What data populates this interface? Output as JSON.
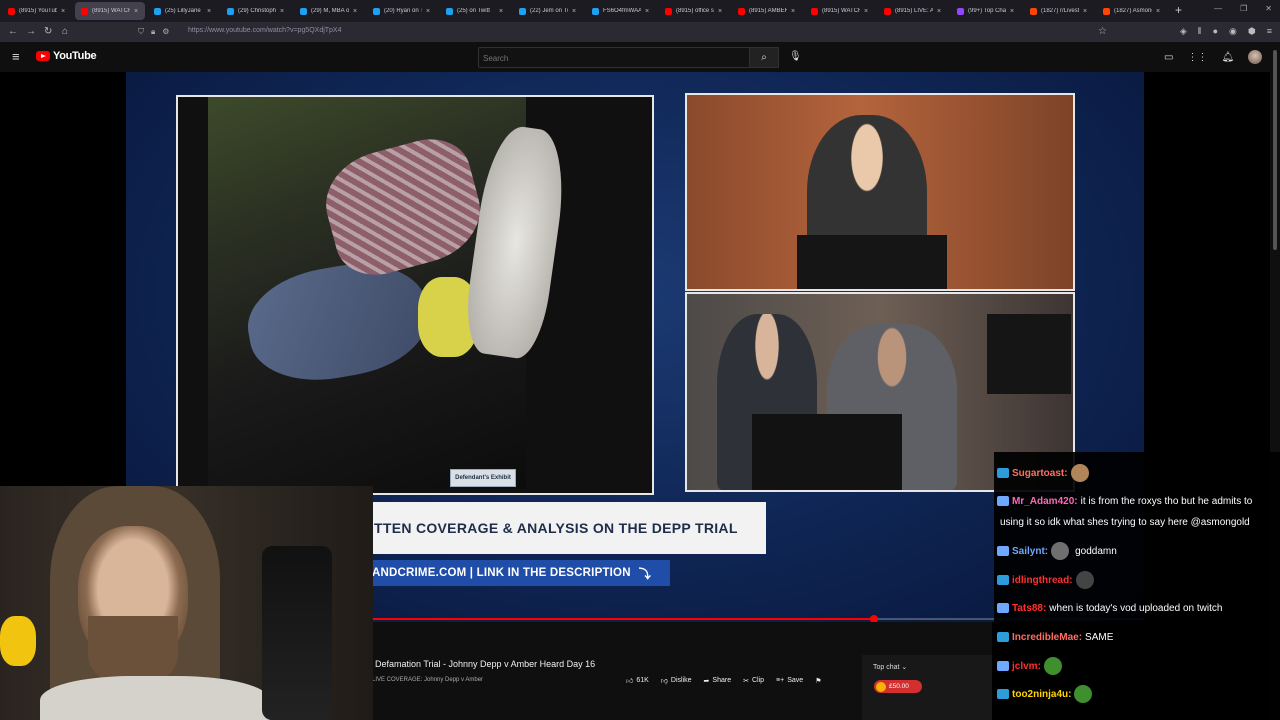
{
  "browser": {
    "tabs": [
      {
        "label": "(8915) YouTube",
        "color": "#ff0000",
        "active": false
      },
      {
        "label": "(8915) WATCH L",
        "color": "#ff0000",
        "active": true
      },
      {
        "label": "(25) LillyJane",
        "color": "#1da1f2",
        "active": false
      },
      {
        "label": "(29) Christophe",
        "color": "#1da1f2",
        "active": false
      },
      {
        "label": "(29) M, MBA on",
        "color": "#1da1f2",
        "active": false
      },
      {
        "label": "(20) Ryan on Twi",
        "color": "#1da1f2",
        "active": false
      },
      {
        "label": "(25) on Twitt",
        "color": "#1da1f2",
        "active": false
      },
      {
        "label": "(22) Jem on Twit",
        "color": "#1da1f2",
        "active": false
      },
      {
        "label": "FS6O4fmWAAU",
        "color": "#1da1f2",
        "active": false
      },
      {
        "label": "(8915) office sp",
        "color": "#ff0000",
        "active": false
      },
      {
        "label": "(8915) AMBER H",
        "color": "#ff0000",
        "active": false
      },
      {
        "label": "(8915) WATCH L",
        "color": "#ff0000",
        "active": false
      },
      {
        "label": "(8915) LIVE: Am",
        "color": "#ff0000",
        "active": false
      },
      {
        "label": "(99+) Top Chan",
        "color": "#9146ff",
        "active": false
      },
      {
        "label": "(1827) r/Livestr",
        "color": "#ff4500",
        "active": false
      },
      {
        "label": "(1827) Asmong",
        "color": "#ff4500",
        "active": false
      }
    ],
    "url": "https://www.youtube.com/watch?v=pg5QXdjTpX4"
  },
  "youtube": {
    "logo_text": "YouTube",
    "search_placeholder": "Search",
    "notification_badge": "9+"
  },
  "video": {
    "exhibit_label": "Defendant's Exhibit",
    "banner_top": "TTEN COVERAGE & ANALYSIS ON THE DEPP TRIAL",
    "banner_bottom": "ANDCRIME.COM | LINK IN THE DESCRIPTION",
    "progress": 0.65,
    "title": "Defamation Trial - Johnny Depp v Amber Heard Day 16",
    "channel_line": "LIVE COVERAGE: Johnny Depp v Amber",
    "likes": "61K",
    "dislike_label": "Dislike",
    "share_label": "Share",
    "clip_label": "Clip",
    "save_label": "Save"
  },
  "topchat": {
    "header": "Top chat",
    "donation": "£50.00"
  },
  "chat": {
    "messages": [
      {
        "user": "Sugartoast:",
        "color": "#ff6f61",
        "text": ""
      },
      {
        "user": "Mr_Adam420:",
        "color": "#ff69b4",
        "text": "it is from the roxys tho but he admits to"
      },
      {
        "user": "",
        "color": "#ffffff",
        "text": "using it so idk what shes trying to say here @asmongold"
      },
      {
        "user": "Sailynt:",
        "color": "#6fa8ff",
        "text": "goddamn"
      },
      {
        "user": "idlingthread:",
        "color": "#ff3030",
        "text": ""
      },
      {
        "user": "Tats88:",
        "color": "#ff3030",
        "text": "when is today's vod uploaded on twitch"
      },
      {
        "user": "IncredibleMae:",
        "color": "#ff6f61",
        "text": "SAME"
      },
      {
        "user": "jclvm:",
        "color": "#ff3030",
        "text": ""
      },
      {
        "user": "too2ninja4u:",
        "color": "#ffd400",
        "text": ""
      }
    ]
  }
}
